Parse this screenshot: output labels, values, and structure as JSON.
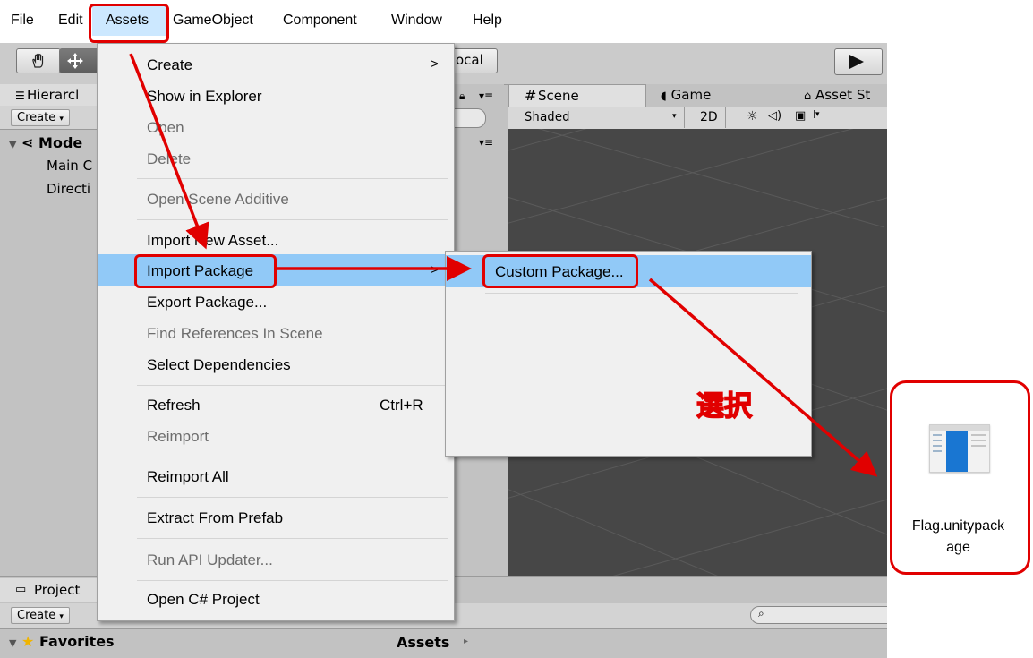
{
  "menubar": {
    "items": [
      "File",
      "Edit",
      "Assets",
      "GameObject",
      "Component",
      "Window",
      "Help"
    ]
  },
  "toolbar": {
    "pivot_label": "ocal"
  },
  "hierarchy": {
    "tab_label": "Hierarcl",
    "create_label": "Create",
    "scene_name": "Mode",
    "items": [
      "Main C",
      "Directi"
    ]
  },
  "scene_view": {
    "tabs": [
      "Scene",
      "Game",
      "Asset St"
    ],
    "shading": "Shaded",
    "mode_2d": "2D"
  },
  "project": {
    "tab_label": "Project",
    "create_label": "Create",
    "favorites_label": "Favorites",
    "assets_label": "Assets"
  },
  "assets_menu": {
    "items": [
      {
        "label": "Create",
        "disabled": false
      },
      {
        "label": "Show in Explorer",
        "disabled": false
      },
      {
        "label": "Open",
        "disabled": true
      },
      {
        "label": "Delete",
        "disabled": true
      },
      {
        "label": "Open Scene Additive",
        "disabled": true
      },
      {
        "label": "Import New Asset...",
        "disabled": false
      },
      {
        "label": "Import Package",
        "disabled": false
      },
      {
        "label": "Export Package...",
        "disabled": false
      },
      {
        "label": "Find References In Scene",
        "disabled": true
      },
      {
        "label": "Select Dependencies",
        "disabled": false
      },
      {
        "label": "Refresh",
        "disabled": false
      },
      {
        "label": "Reimport",
        "disabled": true
      },
      {
        "label": "Reimport All",
        "disabled": false
      },
      {
        "label": "Extract From Prefab",
        "disabled": false
      },
      {
        "label": "Run API Updater...",
        "disabled": true
      },
      {
        "label": "Open C# Project",
        "disabled": false
      }
    ],
    "refresh_shortcut": "Ctrl+R",
    "submenu_arrow": ">"
  },
  "submenu": {
    "custom_package": "Custom Package..."
  },
  "annotation": {
    "select_label": "選択"
  },
  "file_icon": {
    "filename_line1": "Flag.unitypack",
    "filename_line2": "age"
  },
  "colors": {
    "highlight": "#91c9f7",
    "annotation_red": "#e10000",
    "scene_bg": "#474747"
  }
}
